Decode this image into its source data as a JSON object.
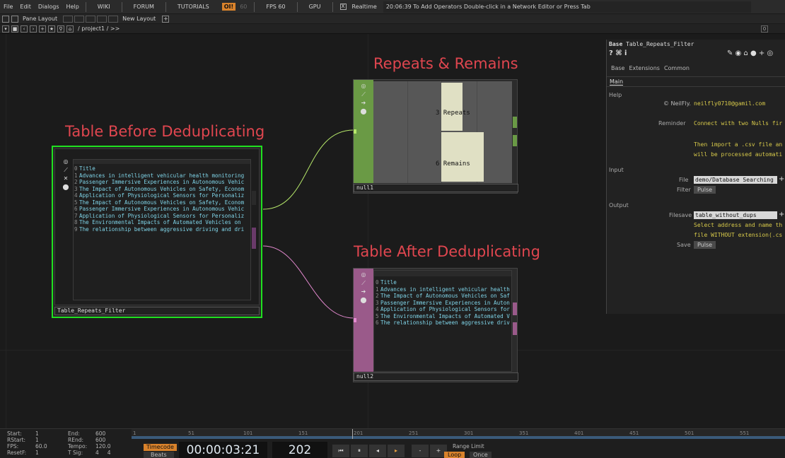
{
  "menubar": {
    "items": [
      "File",
      "Edit",
      "Dialogs",
      "Help"
    ],
    "buttons": [
      "WIKI",
      "FORUM",
      "TUTORIALS"
    ],
    "oit": "OI!",
    "fps_dim": "60",
    "fps": "FPS 60",
    "gpu": "GPU",
    "realtime_check": "X",
    "realtime": "Realtime",
    "status": "20:06:39 To Add Operators Double-click in a Network Editor or Press Tab"
  },
  "panebar": {
    "pane_layout": "Pane Layout",
    "new_layout": "New Layout",
    "plus": "+"
  },
  "pathbar": {
    "path": "/ project1 / >>",
    "right": "0"
  },
  "network": {
    "title_before": "Table Before Deduplicating",
    "title_repeats": "Repeats & Remains",
    "title_after": "Table After Deduplicating",
    "node_filter": {
      "label": "Table_Repeats_Filter",
      "rows": [
        [
          "0",
          "Title"
        ],
        [
          "1",
          "Advances in intelligent vehicular health monitoring"
        ],
        [
          "2",
          "Passenger Immersive Experiences in Autonomous Vehic"
        ],
        [
          "3",
          "The Impact of Autonomous Vehicles on Safety, Econom"
        ],
        [
          "4",
          "Application of Physiological Sensors for Personaliz"
        ],
        [
          "5",
          "The Impact of Autonomous Vehicles on Safety, Econom"
        ],
        [
          "6",
          "Passenger Immersive Experiences in Autonomous Vehic"
        ],
        [
          "7",
          "Application of Physiological Sensors for Personaliz"
        ],
        [
          "8",
          "The Environmental Impacts of Automated Vehicles on"
        ],
        [
          "9",
          "The relationship between aggressive driving and dri"
        ]
      ]
    },
    "node_null1": {
      "label": "null1",
      "repeats": "3 Repeats",
      "remains": "6 Remains"
    },
    "node_null2": {
      "label": "null2",
      "rows": [
        [
          "0",
          "Title"
        ],
        [
          "1",
          "Advances in intelligent vehicular health"
        ],
        [
          "2",
          "The Impact of Autonomous Vehicles on Saf"
        ],
        [
          "3",
          "Passenger Immersive Experiences in Auton"
        ],
        [
          "4",
          "Application of Physiological Sensors for"
        ],
        [
          "5",
          "The Environmental Impacts of Automated V"
        ],
        [
          "6",
          "The relationship between aggressive driv"
        ]
      ]
    }
  },
  "params": {
    "base_label": "Base",
    "op_name": "Table_Repeats_Filter",
    "tabs": [
      "Base",
      "Extensions",
      "Common"
    ],
    "subtab": "Main",
    "help_section": "Help",
    "credit_prefix": "© NeilFly.",
    "credit_email": "neilfly0710@gamil.com",
    "reminder_label": "Reminder",
    "reminder_text": "Connect with two Nulls fir",
    "reminder_line2": "Then import a .csv file an",
    "reminder_line3": "will be processed automati",
    "input_section": "Input",
    "file_label": "File",
    "file_value": "demo/Database Searching",
    "filter_label": "Filter",
    "pulse": "Pulse",
    "output_section": "Output",
    "filesave_label": "Filesave",
    "filesave_value": "table_without_dups",
    "out_line1": "Select address and name th",
    "out_line2": "file WITHOUT extension(.cs",
    "save_label": "Save"
  },
  "timeline": {
    "start_lbl": "Start:",
    "start": "1",
    "end_lbl": "End:",
    "end": "600",
    "rstart_lbl": "RStart:",
    "rstart": "1",
    "rend_lbl": "REnd:",
    "rend": "600",
    "fps_lbl": "FPS:",
    "fps": "60.0",
    "tempo_lbl": "Tempo:",
    "tempo": "120.0",
    "reset_lbl": "ResetF:",
    "reset": "1",
    "tsig_lbl": "T Sig:",
    "tsig": "4     4",
    "timecode": "Timecode",
    "beats": "Beats",
    "time": "00:00:03:21",
    "frame": "202",
    "range_limit": "Range Limit",
    "loop": "Loop",
    "once": "Once",
    "ruler": [
      "1",
      "51",
      "101",
      "151",
      "201",
      "251",
      "301",
      "351",
      "401",
      "451",
      "501",
      "551",
      "60"
    ]
  },
  "colors": {
    "accent_red": "#e0464f",
    "green_op": "#6a9a45",
    "pink_op": "#9a5a8a",
    "selected": "#20e020"
  }
}
